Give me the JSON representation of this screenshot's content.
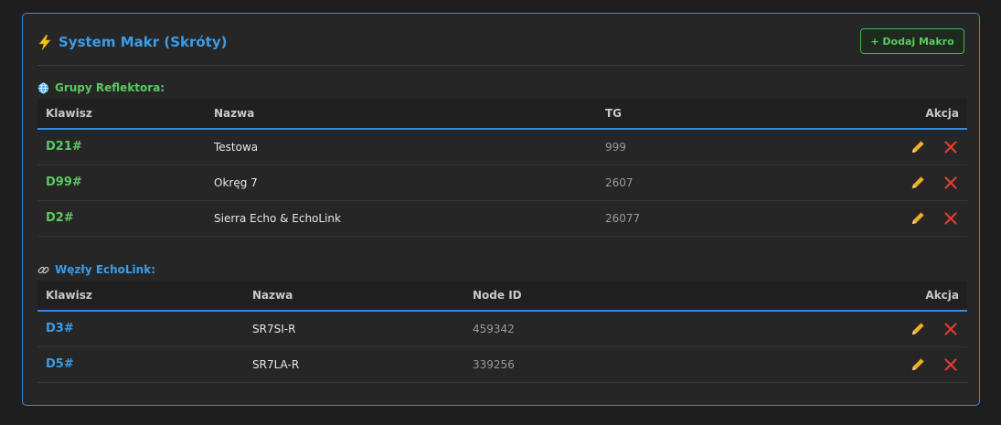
{
  "header": {
    "title": "System Makr (Skróty)",
    "add_button_label": "+ Dodaj Makro"
  },
  "colors": {
    "accent_blue": "#2f8ee0",
    "accent_green": "#5cc862",
    "edit_icon": "#f0b030",
    "delete_icon": "#e03c32"
  },
  "reflector": {
    "section_title": "Grupy Reflektora:",
    "icon": "globe-icon",
    "columns": [
      "Klawisz",
      "Nazwa",
      "TG",
      "Akcja"
    ],
    "rows": [
      {
        "key": "D21#",
        "name": "Testowa",
        "tg": "999"
      },
      {
        "key": "D99#",
        "name": "Okręg 7",
        "tg": "2607"
      },
      {
        "key": "D2#",
        "name": "Sierra Echo & EchoLink",
        "tg": "26077"
      }
    ]
  },
  "echolink": {
    "section_title": "Węzły EchoLink:",
    "icon": "link-icon",
    "columns": [
      "Klawisz",
      "Nazwa",
      "Node ID",
      "Akcja"
    ],
    "rows": [
      {
        "key": "D3#",
        "name": "SR7SI-R",
        "node_id": "459342"
      },
      {
        "key": "D5#",
        "name": "SR7LA-R",
        "node_id": "339256"
      }
    ]
  }
}
